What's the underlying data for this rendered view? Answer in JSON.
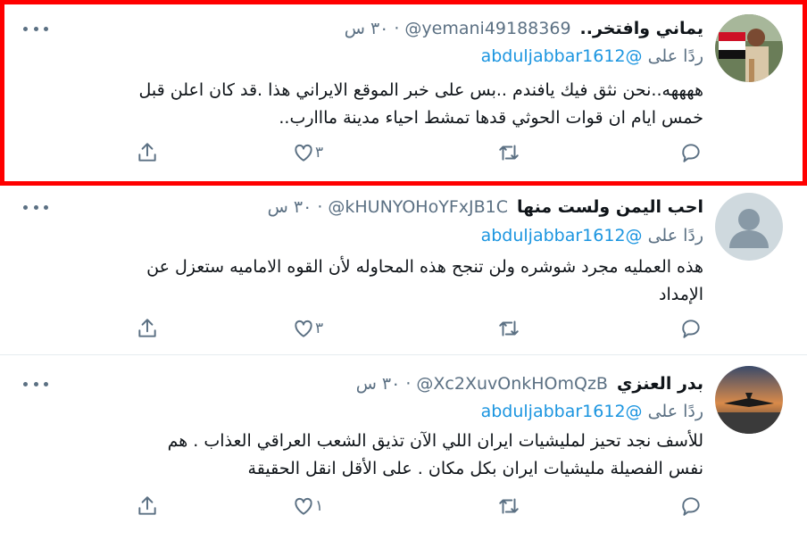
{
  "tweets": [
    {
      "name": "يماني وافتخر..",
      "handle": "@yemani49188369",
      "time": "٣٠ س",
      "replying_prefix": "ردًا على",
      "replying_handle": "abduljabbar1612@",
      "text_lines": [
        "ههههه..نحن نثق فيك يافندم ..بس على خبر الموقع الايراني هذا .قد كان اعلن قبل",
        "خمس ايام ان قوات الحوثي قدها تمشط احياء مدينة مااارب.."
      ],
      "like_count": "٣",
      "highlighted": true
    },
    {
      "name": "احب اليمن ولست منها",
      "handle": "@kHUNYOHoYFxJB1C",
      "time": "٣٠ س",
      "replying_prefix": "ردًا على",
      "replying_handle": "abduljabbar1612@",
      "text_lines": [
        "هذه العمليه مجرد شوشره ولن تنجح  هذه المحاوله لأن القوه الاماميه ستعزل عن",
        "الإمداد"
      ],
      "like_count": "٣",
      "highlighted": false
    },
    {
      "name": "بدر العنزي",
      "handle": "@Xc2XuvOnkHOmQzB",
      "time": "٣٠ س",
      "replying_prefix": "ردًا على",
      "replying_handle": "abduljabbar1612@",
      "text_lines": [
        "للأسف نجد تحيز لمليشيات ايران اللي الآن تذيق الشعب العراقي العذاب . هم",
        "نفس الفصيلة مليشيات ايران بكل مكان . على الأقل انقل الحقيقة"
      ],
      "like_count": "١",
      "highlighted": false
    }
  ],
  "separator": "·",
  "colors": {
    "highlight_border": "#ff0000",
    "link": "#1b95e0",
    "secondary_text": "#5b7083"
  },
  "icons": [
    "more-icon",
    "share-icon",
    "like-icon",
    "retweet-icon",
    "reply-icon"
  ]
}
